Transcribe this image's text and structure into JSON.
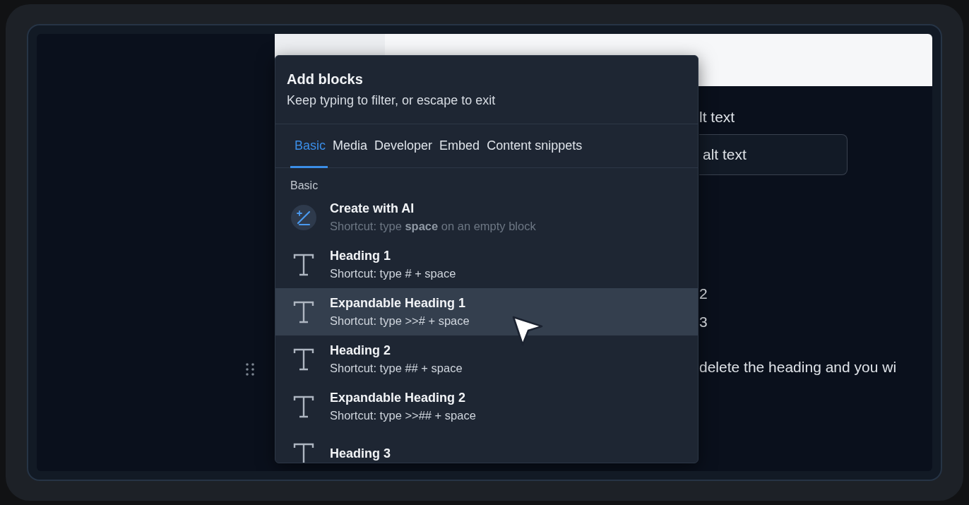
{
  "page": {
    "field_label": "lt text",
    "field_value": "alt text",
    "fragments": [
      "2",
      "3"
    ],
    "paragraph": "delete the heading and you wi"
  },
  "menu": {
    "title": "Add blocks",
    "subtitle": "Keep typing to filter, or escape to exit",
    "tabs": [
      {
        "label": "Basic",
        "selected": true
      },
      {
        "label": "Media",
        "selected": false
      },
      {
        "label": "Developer",
        "selected": false
      },
      {
        "label": "Embed",
        "selected": false
      },
      {
        "label": "Content snippets",
        "selected": false
      }
    ],
    "section": "Basic",
    "items": [
      {
        "kind": "ai",
        "title": "Create with AI",
        "shortcut": "Shortcut: type **space** on an empty block",
        "selected": false
      },
      {
        "kind": "text",
        "title": "Heading 1",
        "shortcut": "Shortcut: type # + space",
        "selected": false
      },
      {
        "kind": "text",
        "title": "Expandable Heading 1",
        "shortcut": "Shortcut: type >># + space",
        "selected": true
      },
      {
        "kind": "text",
        "title": "Heading 2",
        "shortcut": "Shortcut: type ## + space",
        "selected": false
      },
      {
        "kind": "text",
        "title": "Expandable Heading 2",
        "shortcut": "Shortcut: type >>## + space",
        "selected": false
      },
      {
        "kind": "text",
        "title": "Heading 3",
        "selected": false
      }
    ]
  }
}
